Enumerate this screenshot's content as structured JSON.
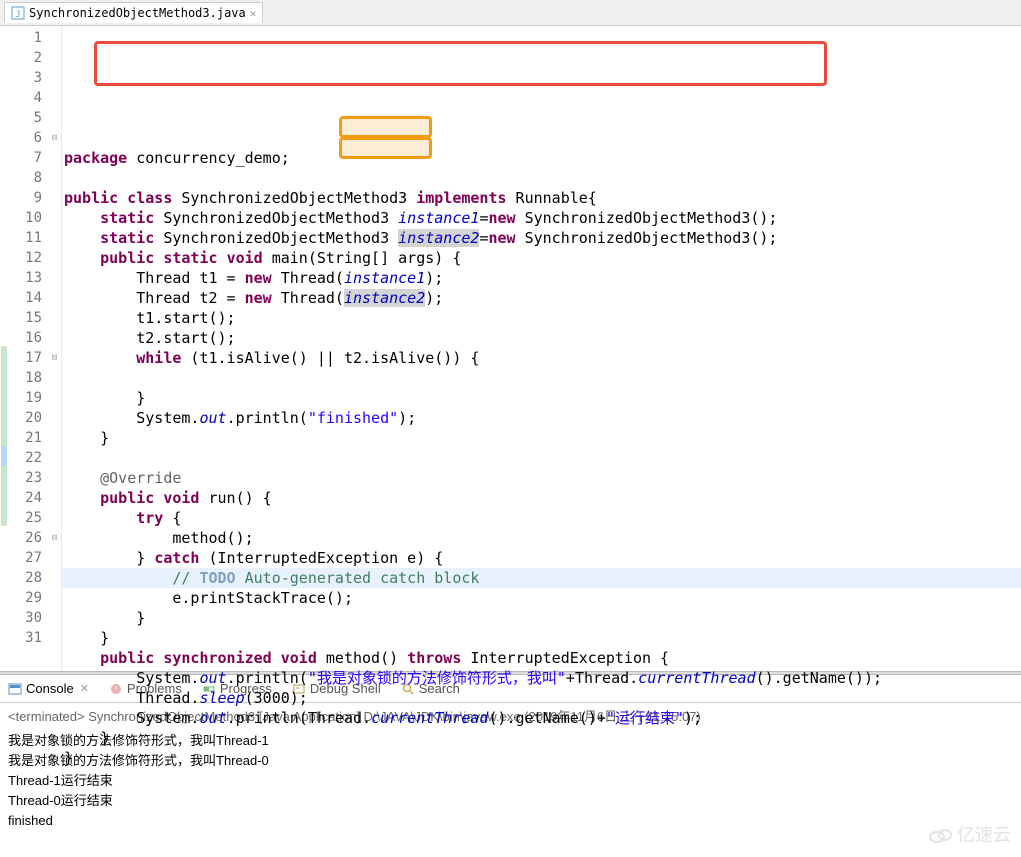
{
  "tab": {
    "filename": "SynchronizedObjectMethod3.java"
  },
  "code": {
    "lines": [
      {
        "n": "1",
        "html": "<span class='kw'>package</span> concurrency_demo;"
      },
      {
        "n": "2",
        "html": ""
      },
      {
        "n": "3",
        "html": "<span class='kw'>public</span> <span class='kw'>class</span> SynchronizedObjectMethod3 <span class='kw'>implements</span> Runnable{"
      },
      {
        "n": "4",
        "html": "    <span class='kw'>static</span> SynchronizedObjectMethod3 <span class='field-it'>instance1</span>=<span class='kw'>new</span> SynchronizedObjectMethod3();"
      },
      {
        "n": "5",
        "html": "    <span class='kw'>static</span> SynchronizedObjectMethod3 <span class='field-it sel-bg'>instance2</span>=<span class='kw'>new</span> SynchronizedObjectMethod3();"
      },
      {
        "n": "6",
        "html": "    <span class='kw'>public</span> <span class='kw'>static</span> <span class='kw'>void</span> main(String[] args) {",
        "fold": "⊟"
      },
      {
        "n": "7",
        "html": "        Thread t1 = <span class='kw'>new</span> Thread(<span class='field-it'>instance1</span>);"
      },
      {
        "n": "8",
        "html": "        Thread t2 = <span class='kw'>new</span> Thread(<span class='field-it sel-bg'>instance2</span>);"
      },
      {
        "n": "9",
        "html": "        t1.start();"
      },
      {
        "n": "10",
        "html": "        t2.start();"
      },
      {
        "n": "11",
        "html": "        <span class='kw'>while</span> (t1.isAlive() || t2.isAlive()) {"
      },
      {
        "n": "12",
        "html": ""
      },
      {
        "n": "13",
        "html": "        }"
      },
      {
        "n": "14",
        "html": "        System.<span class='static-it'>out</span>.println(<span class='str'>\"finished\"</span>);"
      },
      {
        "n": "15",
        "html": "    }"
      },
      {
        "n": "16",
        "html": ""
      },
      {
        "n": "17",
        "html": "    <span class='ann'>@Override</span>",
        "fold": "⊟",
        "marker": "green"
      },
      {
        "n": "18",
        "html": "    <span class='kw'>public</span> <span class='kw'>void</span> run() {",
        "marker": "green"
      },
      {
        "n": "19",
        "html": "        <span class='kw'>try</span> {",
        "marker": "green"
      },
      {
        "n": "20",
        "html": "            method();",
        "marker": "green"
      },
      {
        "n": "21",
        "html": "        } <span class='kw'>catch</span> (InterruptedException e) {",
        "marker": "green"
      },
      {
        "n": "22",
        "html": "            <span class='comment'>// </span><span class='todo'>TODO</span><span class='comment'> Auto-generated catch block</span>",
        "marker": "blue",
        "highlight": true
      },
      {
        "n": "23",
        "html": "            e.printStackTrace();",
        "marker": "green"
      },
      {
        "n": "24",
        "html": "        }",
        "marker": "green"
      },
      {
        "n": "25",
        "html": "    }",
        "marker": "green"
      },
      {
        "n": "26",
        "html": "    <span class='kw'>public</span> <span class='kw'>synchronized</span> <span class='kw'>void</span> method() <span class='kw'>throws</span> InterruptedException {",
        "fold": "⊟"
      },
      {
        "n": "27",
        "html": "        System.<span class='static-it'>out</span>.println(<span class='str'>\"我是对象锁的方法修饰符形式，我叫\"</span>+Thread.<span class='static-it'>currentThread</span>().getName());"
      },
      {
        "n": "28",
        "html": "        Thread.<span class='static-it'>sleep</span>(3000);"
      },
      {
        "n": "29",
        "html": "        System.<span class='static-it'>out</span>.println(Thread.<span class='static-it'>currentThread</span>().getName()+<span class='str'>\"运行结束\"</span>);"
      },
      {
        "n": "30",
        "html": "    }"
      },
      {
        "n": "31",
        "html": "}"
      }
    ]
  },
  "bottom_tabs": {
    "console": "Console",
    "problems": "Problems",
    "progress": "Progress",
    "debug_shell": "Debug Shell",
    "search": "Search"
  },
  "console": {
    "header": "<terminated> SynchronizedObjectMethod3 [Java Application] D:\\JAVA\\JDK\\bin\\javaw.exe (2019年11月6日 上午11:25:07)",
    "lines": [
      "我是对象锁的方法修饰符形式，我叫Thread-1",
      "我是对象锁的方法修饰符形式，我叫Thread-0",
      "Thread-1运行结束",
      "Thread-0运行结束",
      "finished"
    ]
  },
  "watermark": "亿速云"
}
